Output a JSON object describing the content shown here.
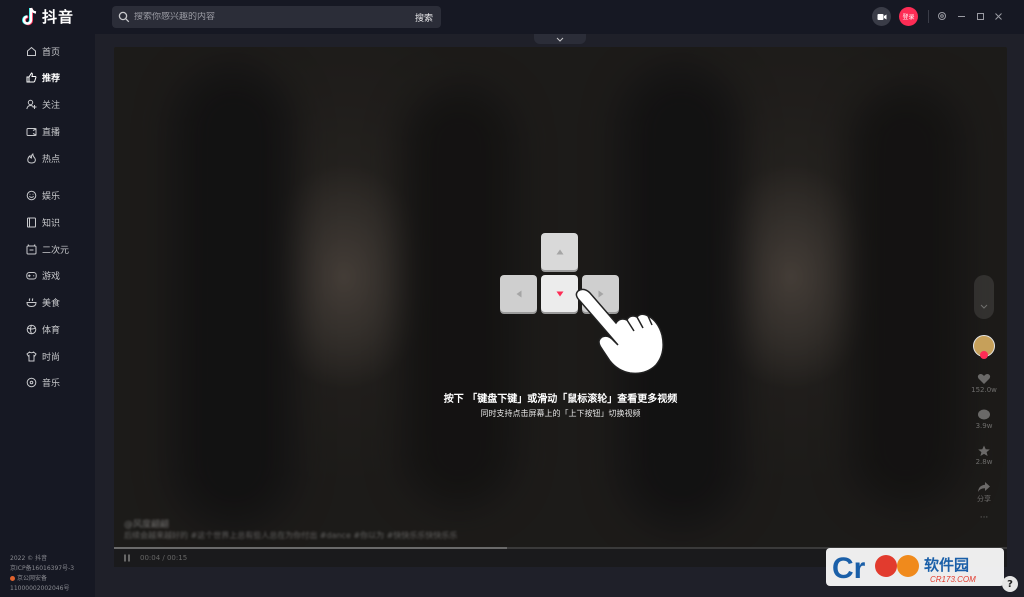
{
  "app": {
    "name": "抖音"
  },
  "search": {
    "placeholder": "搜索你感兴趣的内容",
    "button": "搜索"
  },
  "header": {
    "login_label": "登录"
  },
  "sidebar": {
    "items": [
      {
        "label": "首页",
        "icon": "home-icon"
      },
      {
        "label": "推荐",
        "icon": "thumbs-up-icon",
        "active": true
      },
      {
        "label": "关注",
        "icon": "user-plus-icon"
      },
      {
        "label": "直播",
        "icon": "tv-icon"
      },
      {
        "label": "热点",
        "icon": "flame-icon"
      },
      {
        "label": "娱乐",
        "icon": "smile-icon"
      },
      {
        "label": "知识",
        "icon": "book-icon"
      },
      {
        "label": "二次元",
        "icon": "anime-icon"
      },
      {
        "label": "游戏",
        "icon": "gamepad-icon"
      },
      {
        "label": "美食",
        "icon": "bowl-icon"
      },
      {
        "label": "体育",
        "icon": "ball-icon"
      },
      {
        "label": "时尚",
        "icon": "shirt-icon"
      },
      {
        "label": "音乐",
        "icon": "music-icon"
      }
    ],
    "footer": [
      "2022 © 抖音",
      "京ICP备16016397号-3",
      "京公网安备",
      "11000002002046号"
    ]
  },
  "player": {
    "hint_main": "按下 「键盘下键」或滑动「鼠标滚轮」查看更多视频",
    "hint_sub": "同时支持点击屏幕上的「上下按钮」切换视频",
    "author": "@风度翩翩",
    "description": "后续会越来越好的 #这个世界上总有些人总在为你付出 #dance #你以为 #快快乐乐快快乐乐",
    "time": "00:04 / 00:15",
    "progress": 0.44,
    "actions": {
      "likes": "152.0w",
      "comments": "3.9w",
      "favorites": "2.8w",
      "share": "分享"
    }
  },
  "watermark": {
    "text": "软件园",
    "domain": "CR173.COM"
  },
  "colors": {
    "accent": "#fe2c55",
    "bg": "#161823",
    "panel": "#1f2029"
  }
}
